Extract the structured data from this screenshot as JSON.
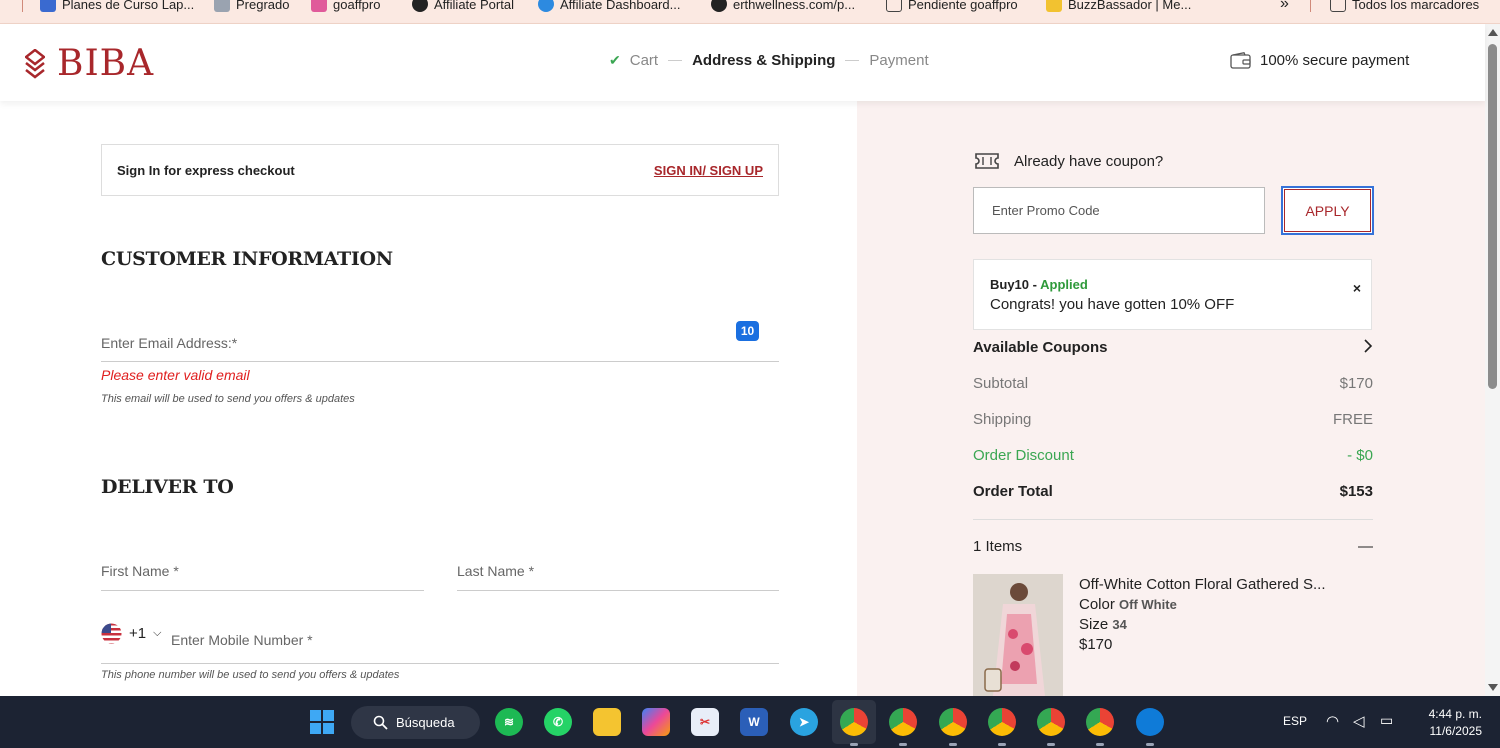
{
  "browser": {
    "bookmarks": [
      {
        "label": "Planes de Curso Lap...",
        "icon": "wiki-icon"
      },
      {
        "label": "Pregrado",
        "icon": "page-icon"
      },
      {
        "label": "goaffpro",
        "icon": "shop-icon"
      },
      {
        "label": "Affiliate Portal",
        "icon": "globe-icon"
      },
      {
        "label": "Affiliate Dashboard...",
        "icon": "globe-icon"
      },
      {
        "label": "erthwellness.com/p...",
        "icon": "globe-icon"
      },
      {
        "label": "Pendiente goaffpro",
        "icon": "folder-icon"
      },
      {
        "label": "BuzzBassador | Me...",
        "icon": "bee-icon"
      }
    ],
    "more_label": "»",
    "all_bookmarks_label": "Todos los marcadores"
  },
  "header": {
    "brand": "BIBA",
    "steps": {
      "cart": "Cart",
      "address": "Address & Shipping",
      "payment": "Payment"
    },
    "secure_label": "100% secure payment"
  },
  "signin": {
    "text": "Sign In for express checkout",
    "link": "SIGN IN/ SIGN UP"
  },
  "customer": {
    "title": "CUSTOMER INFORMATION",
    "email_placeholder": "Enter Email Address:*",
    "email_error": "Please enter valid email",
    "email_hint": "This email will be used to send you offers & updates",
    "ext_badge": "10"
  },
  "deliver": {
    "title": "DELIVER TO",
    "first_name_placeholder": "First Name *",
    "last_name_placeholder": "Last Name *",
    "country_code": "+1",
    "mobile_placeholder": "Enter Mobile Number *",
    "mobile_hint": "This phone number will be used to send you offers & updates"
  },
  "summary": {
    "coupon_title": "Already have coupon?",
    "promo_placeholder": "Enter Promo Code",
    "apply_label": "APPLY",
    "applied_code": "Buy10",
    "applied_sep": " - ",
    "applied_status": "Applied",
    "applied_message": "Congrats! you have gotten 10% OFF",
    "close_label": "×",
    "available_coupons": "Available Coupons",
    "subtotal_label": "Subtotal",
    "subtotal_value": "$170",
    "shipping_label": "Shipping",
    "shipping_value": "FREE",
    "discount_label": "Order Discount",
    "discount_value": "- $0",
    "total_label": "Order Total",
    "total_value": "$153",
    "items_label": "1 Items",
    "collapse_label": "—",
    "product": {
      "name": "Off-White Cotton Floral Gathered S...",
      "color_label": "Color",
      "color_value": "Off White",
      "size_label": "Size",
      "size_value": "34",
      "price": "$170"
    }
  },
  "taskbar": {
    "search_label": "Búsqueda",
    "language": "ESP",
    "time": "4:44 p. m.",
    "date": "11/6/2025"
  },
  "colors": {
    "brand": "#a8272b",
    "success": "#3aa652",
    "error": "#e02020",
    "summary_bg": "#faf1f0"
  }
}
